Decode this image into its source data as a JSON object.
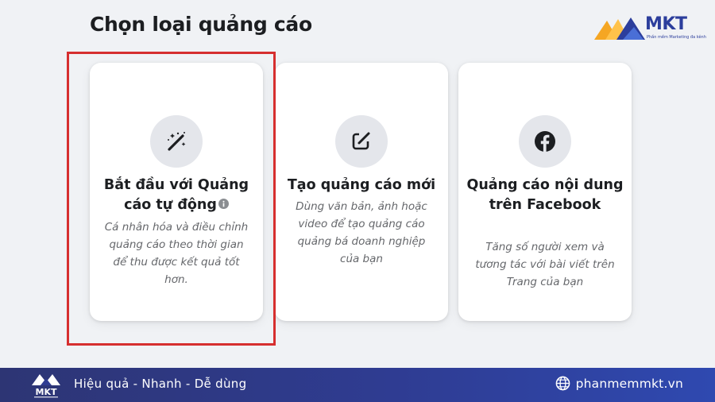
{
  "header": {
    "title": "Chọn loại quảng cáo",
    "brand": {
      "word": "MKT",
      "tagline": "Phần mềm Marketing đa kênh"
    }
  },
  "cards": [
    {
      "icon": "magic-wand-icon",
      "title": "Bắt đầu với Quảng cáo tự động",
      "description": "Cá nhân hóa và điều chỉnh quảng cáo theo thời gian để thu được kết quả tốt hơn.",
      "selected": true
    },
    {
      "icon": "edit-icon",
      "title": "Tạo quảng cáo mới",
      "description": "Dùng văn bản, ảnh hoặc video để tạo quảng cáo quảng bá doanh nghiệp của bạn",
      "selected": false
    },
    {
      "icon": "facebook-icon",
      "title": "Quảng cáo nội dung trên Facebook",
      "description": "Tăng số người xem và tương tác với bài viết trên Trang của bạn",
      "selected": false
    }
  ],
  "footer": {
    "slogan": "Hiệu quả - Nhanh - Dễ dùng",
    "website": "phanmemmkt.vn"
  },
  "colors": {
    "highlight": "#d62f2f",
    "footer_bg": "#2f3c92",
    "card_bg": "#ffffff",
    "icon_circle": "#e4e6eb"
  }
}
